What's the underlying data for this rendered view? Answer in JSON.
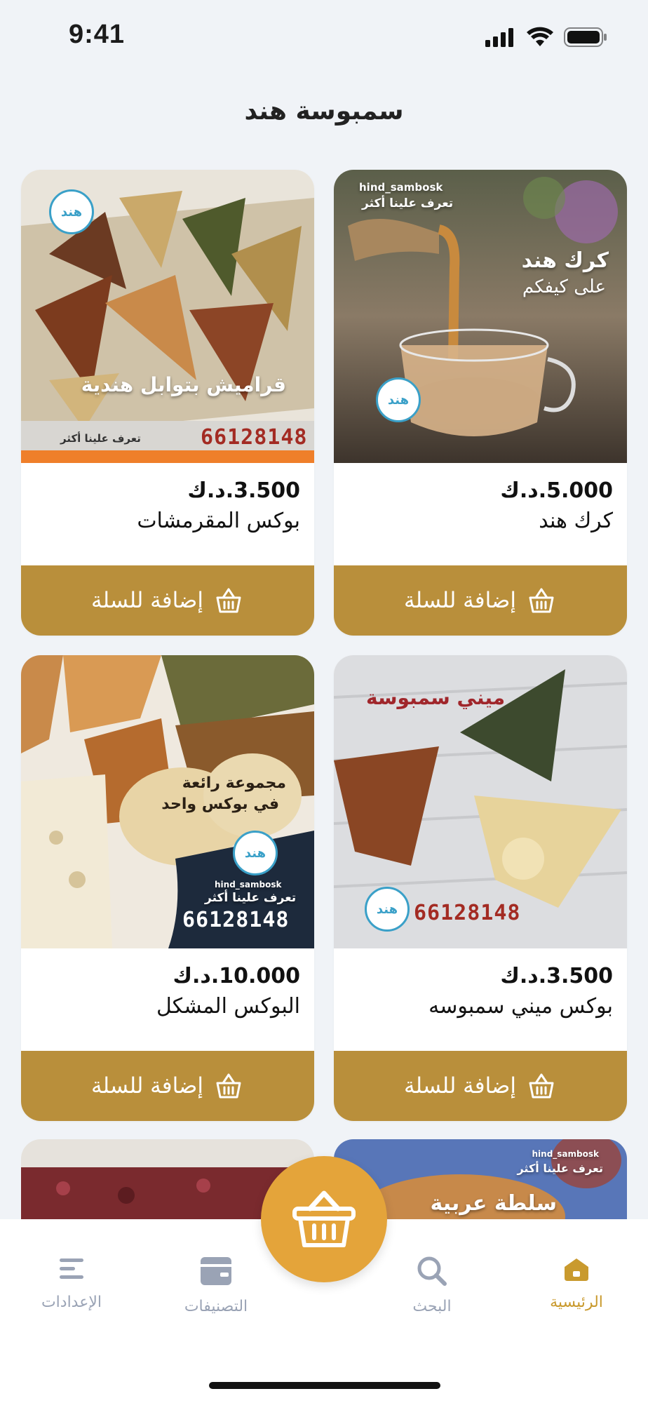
{
  "status_bar": {
    "time": "9:41"
  },
  "header": {
    "title": "سمبوسة هند"
  },
  "products": [
    {
      "name": "كرك هند",
      "price": "5.000.د.ك",
      "add_label": "إضافة للسلة",
      "image_texts": {
        "social": "hind_sambosk",
        "learn": "تعرف علينا أكثر",
        "headline1": "كرك هند",
        "headline2": "على كيفكم",
        "logo": "هند"
      }
    },
    {
      "name": "بوكس المقرمشات",
      "price": "3.500.د.ك",
      "add_label": "إضافة للسلة",
      "image_texts": {
        "headline": "قراميش بتوابل هندية",
        "phone": "66128148",
        "learn": "تعرف علينا أكثر",
        "logo": "هند"
      }
    },
    {
      "name": "بوكس ميني سمبوسه",
      "price": "3.500.د.ك",
      "add_label": "إضافة للسلة",
      "image_texts": {
        "headline": "ميني سمبوسة",
        "phone": "66128148",
        "logo": "هند"
      }
    },
    {
      "name": "البوكس المشكل",
      "price": "10.000.د.ك",
      "add_label": "إضافة للسلة",
      "image_texts": {
        "headline1": "مجموعة رائعة",
        "headline2": "في بوكس واحد",
        "social": "hind_sambosk",
        "learn": "تعرف علينا أكثر",
        "phone": "66128148",
        "logo": "هند"
      }
    }
  ],
  "partial_products": [
    {
      "image_texts": {
        "social": "hind_sambosk",
        "learn": "تعرف علينا أكثر",
        "headline": "سلطة عربية"
      }
    },
    {
      "image_texts": {}
    }
  ],
  "tabbar": {
    "home": "الرئيسية",
    "search": "البحث",
    "categories": "التصنيفات",
    "settings": "الإعدادات"
  },
  "colors": {
    "accent": "#b98f3b",
    "fab": "#e4a43a",
    "active_tab": "#c99a2e",
    "inactive_tab": "#9aa3b5",
    "background": "#f0f3f7"
  },
  "icons": [
    "signal-icon",
    "wifi-icon",
    "battery-icon",
    "basket-icon",
    "home-icon",
    "search-icon",
    "categories-icon",
    "settings-icon"
  ]
}
